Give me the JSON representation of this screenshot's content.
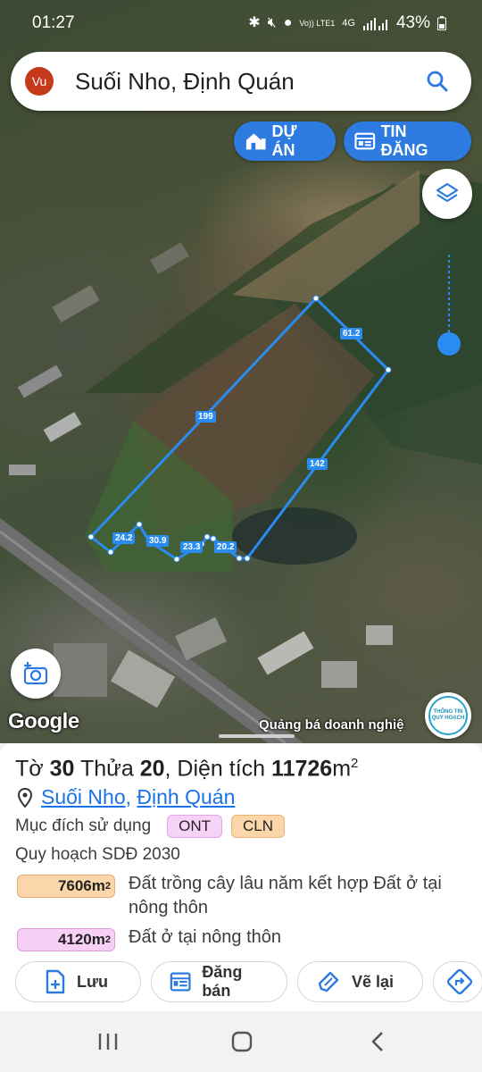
{
  "status_bar": {
    "time": "01:27",
    "network_label": "Vo)) LTE1",
    "signal_label": "4G",
    "battery": "43%"
  },
  "search": {
    "avatar": "Vu",
    "query": "Suối Nho, Định Quán",
    "icon": "search-icon"
  },
  "map_buttons": {
    "project_label": "DỰ ÁN",
    "listing_label": "TIN ĐĂNG",
    "layers_icon": "layers-icon",
    "camera_icon": "add-photo-icon"
  },
  "map_overlay": {
    "google_logo": "Google",
    "promo_text": "Quảng bá doanh nghiệ",
    "promo_badge": "THÔNG TIN QUY HOẠCH",
    "edge_lengths": [
      "61.2",
      "199",
      "142",
      "24.2",
      "30.9",
      "23.3",
      "20.2"
    ]
  },
  "parcel": {
    "sheet_label": "Tờ",
    "sheet_no": "30",
    "parcel_label": "Thửa",
    "parcel_no": "20",
    "area_label": ", Diện tích",
    "area": "11726",
    "area_unit": "m",
    "area_unit_sup": "2",
    "commune": "Suối Nho",
    "district": "Định Quán",
    "usage_label": "Mục đích sử dụng",
    "usage_tags": [
      "ONT",
      "CLN"
    ],
    "plan_label": "Quy hoạch SDĐ 2030",
    "zones": [
      {
        "area": "7606m",
        "sup": "2",
        "desc": "Đất trồng cây lâu năm kết hợp Đất ở tại nông thôn",
        "color": "#fbd6a9"
      },
      {
        "area": "4120m",
        "sup": "2",
        "desc": "Đất ở tại nông thôn",
        "color": "#f9d0f5"
      }
    ]
  },
  "actions": {
    "save": "Lưu",
    "sell": "Đăng bán",
    "redraw": "Vẽ lại",
    "directions_icon": "directions-icon"
  },
  "colors": {
    "accent": "#2d7be0",
    "boundary": "#2a8cf0"
  }
}
